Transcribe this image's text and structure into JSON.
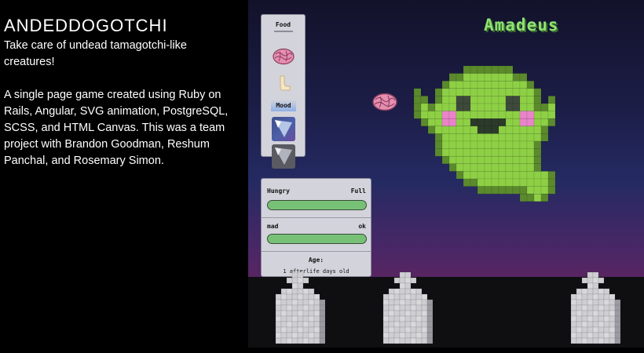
{
  "about": {
    "title": "ANDEDDOGOTCHI",
    "tagline": "Take care of undead tamagotchi-like creatures!",
    "description": "A single page game created using Ruby on Rails, Angular, SVG animation, PostgreSQL, SCSS, and HTML Canvas. This was a team project with Brandon Goodman, Reshum Panchal, and Rosemary Simon."
  },
  "game": {
    "pet_name": "Amadeus",
    "menu": {
      "food_label": "Food",
      "mood_label": "Mood",
      "food_items": [
        {
          "icon": "brain-icon"
        },
        {
          "icon": "bone-icon"
        }
      ],
      "mood_items": [
        {
          "icon": "spotlight-icon"
        },
        {
          "icon": "spotlight-icon"
        }
      ]
    },
    "stats": {
      "hunger": {
        "label": "Hungry",
        "status": "Full",
        "level": 1.0
      },
      "mood": {
        "label": "mad",
        "status": "ok",
        "level": 1.0
      },
      "age_label": "Age:",
      "age_value": "1 afterlife days old"
    },
    "colors": {
      "ghost": "#8ed045",
      "ghost_outline": "#5b8a2c",
      "cheeks": "#ea84c9",
      "name": "#8fe272",
      "bar_fill": "#77c177"
    }
  }
}
